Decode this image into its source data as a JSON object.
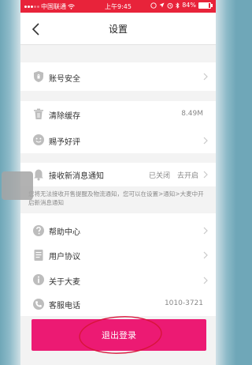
{
  "status_bar": {
    "carrier": "中国联通",
    "time": "上午9:45",
    "battery_text": "84%",
    "battery_level": 0.84
  },
  "nav": {
    "title": "设置"
  },
  "rows": {
    "account_security": {
      "label": "账号安全"
    },
    "clear_cache": {
      "label": "清除缓存",
      "value": "8.49M"
    },
    "rate": {
      "label": "赐予好评"
    },
    "notifications": {
      "label": "接收新消息通知",
      "status": "已关闭",
      "action": "去开启"
    },
    "help": {
      "label": "帮助中心"
    },
    "agreement": {
      "label": "用户协议"
    },
    "about": {
      "label": "关于大麦"
    },
    "phone": {
      "label": "客服电话",
      "value": "1010-3721"
    }
  },
  "notice": {
    "text": "您将无法接收开售提醒及物流通知，您可以在设置>通知>大麦中开启新消息通知"
  },
  "logout": {
    "label": "退出登录"
  },
  "colors": {
    "status_bar": "#e8233a",
    "logout_button": "#ec1a73",
    "annotation_circle": "#d8143a"
  },
  "icons": {
    "back": "chevron-left-icon",
    "shield": "shield-icon",
    "trash": "trash-icon",
    "smile": "smile-icon",
    "bell": "bell-icon",
    "help": "help-icon",
    "document": "document-icon",
    "info": "info-icon",
    "phone": "phone-icon",
    "chevron": "chevron-right-icon"
  }
}
